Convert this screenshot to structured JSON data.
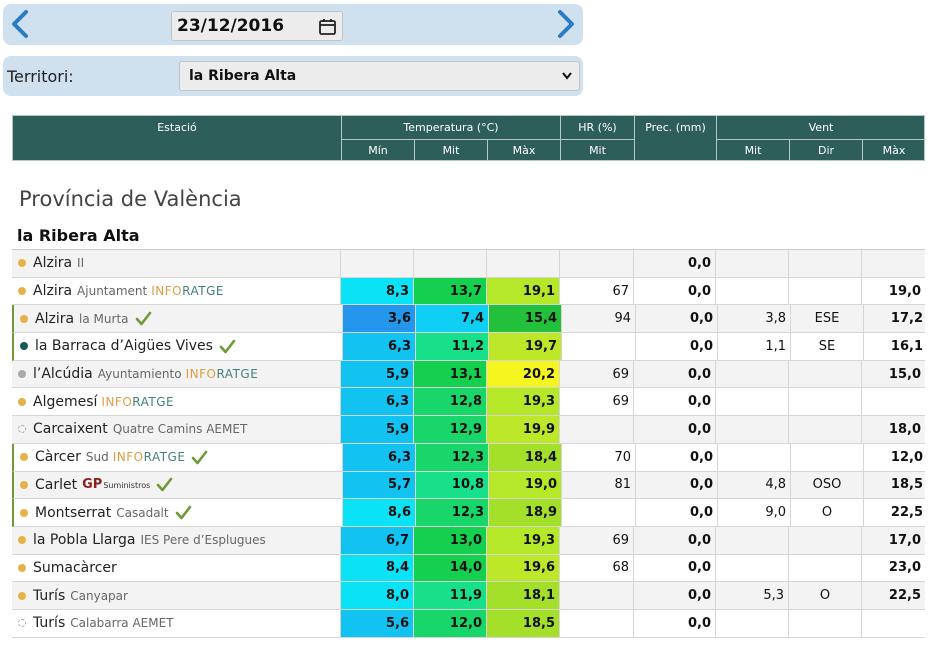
{
  "date_bar": {
    "date_value": "23/12/2016",
    "prev_icon": "chevron-left-icon",
    "next_icon": "chevron-right-icon",
    "calendar_icon": "calendar-icon",
    "accent_color": "#2a7bc4"
  },
  "territory": {
    "label": "Territori:",
    "selected": "la Ribera Alta"
  },
  "table_header": {
    "station": "Estació",
    "temperature": "Temperatura (°C)",
    "temp_min": "Mín",
    "temp_mit": "Mit",
    "temp_max": "Màx",
    "hr": "HR (%)",
    "hr_mit": "Mit",
    "prec": "Prec. (mm)",
    "vent": "Vent",
    "vent_mit": "Mit",
    "vent_dir": "Dir",
    "vent_max": "Màx",
    "bg_color": "#2e5e5a"
  },
  "province": "Província de València",
  "comarca": "la Ribera Alta",
  "stations": [
    {
      "name": "Alzira",
      "sub": "II",
      "dot": "#e3b34a",
      "marked": false,
      "info": false,
      "gp": false,
      "check": false,
      "min": "",
      "mit": "",
      "max": "",
      "hr": "",
      "prec": "0,0",
      "vmit": "",
      "vdir": "",
      "vmax": "",
      "min_color": "",
      "mit_color": "",
      "max_color": ""
    },
    {
      "name": "Alzira",
      "sub": "Ajuntament",
      "dot": "#e3b34a",
      "marked": false,
      "info": true,
      "gp": false,
      "check": false,
      "min": "8,3",
      "mit": "13,7",
      "max": "19,1",
      "hr": "67",
      "prec": "0,0",
      "vmit": "",
      "vdir": "",
      "vmax": "19,0",
      "min_color": "#0ce2f6",
      "mit_color": "#15cf4f",
      "max_color": "#b6e82a"
    },
    {
      "name": "Alzira",
      "sub": "la Murta",
      "dot": "#e3b34a",
      "marked": true,
      "info": false,
      "gp": false,
      "check": true,
      "min": "3,6",
      "mit": "7,4",
      "max": "15,4",
      "hr": "94",
      "prec": "0,0",
      "vmit": "3,8",
      "vdir": "ESE",
      "vmax": "17,2",
      "min_color": "#2496ec",
      "mit_color": "#10cff4",
      "max_color": "#22c03b"
    },
    {
      "name": "la Barraca d’Aigües Vives",
      "sub": "",
      "dot": "#115a5a",
      "marked": true,
      "info": false,
      "gp": false,
      "check": true,
      "min": "6,3",
      "mit": "11,2",
      "max": "19,7",
      "hr": "",
      "prec": "0,0",
      "vmit": "1,1",
      "vdir": "SE",
      "vmax": "16,1",
      "min_color": "#12c3f1",
      "mit_color": "#18e08a",
      "max_color": "#bde82a"
    },
    {
      "name": "l’Alcúdia",
      "sub": "Ayuntamiento",
      "dot": "#aaaaaa",
      "marked": false,
      "info": true,
      "gp": false,
      "check": false,
      "min": "5,9",
      "mit": "13,1",
      "max": "20,2",
      "hr": "69",
      "prec": "0,0",
      "vmit": "",
      "vdir": "",
      "vmax": "15,0",
      "min_color": "#12c3f1",
      "mit_color": "#15cf4f",
      "max_color": "#f5f520"
    },
    {
      "name": "Algemesí",
      "sub": "",
      "dot": "#e3b34a",
      "marked": false,
      "info": true,
      "gp": false,
      "check": false,
      "min": "6,3",
      "mit": "12,8",
      "max": "19,3",
      "hr": "69",
      "prec": "0,0",
      "vmit": "",
      "vdir": "",
      "vmax": "",
      "min_color": "#12c3f1",
      "mit_color": "#18d66a",
      "max_color": "#b6e82a"
    },
    {
      "name": "Carcaixent",
      "sub": "Quatre Camins AEMET",
      "dot": "dashed",
      "marked": false,
      "info": false,
      "gp": false,
      "check": false,
      "min": "5,9",
      "mit": "12,9",
      "max": "19,9",
      "hr": "",
      "prec": "0,0",
      "vmit": "",
      "vdir": "",
      "vmax": "18,0",
      "min_color": "#12c3f1",
      "mit_color": "#18d66a",
      "max_color": "#bde82a"
    },
    {
      "name": "Càrcer",
      "sub": "Sud",
      "dot": "#e3b34a",
      "marked": true,
      "info": true,
      "gp": false,
      "check": true,
      "min": "6,3",
      "mit": "12,3",
      "max": "18,4",
      "hr": "70",
      "prec": "0,0",
      "vmit": "",
      "vdir": "",
      "vmax": "12,0",
      "min_color": "#12c3f1",
      "mit_color": "#18d66a",
      "max_color": "#a4e02a"
    },
    {
      "name": "Carlet",
      "sub": "",
      "dot": "#e3b34a",
      "marked": true,
      "info": false,
      "gp": true,
      "check": true,
      "min": "5,7",
      "mit": "10,8",
      "max": "19,0",
      "hr": "81",
      "prec": "0,0",
      "vmit": "4,8",
      "vdir": "OSO",
      "vmax": "18,5",
      "min_color": "#12c3f1",
      "mit_color": "#18e08a",
      "max_color": "#b6e82a"
    },
    {
      "name": "Montserrat",
      "sub": "Casadalt",
      "dot": "#e3b34a",
      "marked": true,
      "info": false,
      "gp": false,
      "check": true,
      "min": "8,6",
      "mit": "12,3",
      "max": "18,9",
      "hr": "",
      "prec": "0,0",
      "vmit": "9,0",
      "vdir": "O",
      "vmax": "22,5",
      "min_color": "#0ce2f6",
      "mit_color": "#18d66a",
      "max_color": "#a4e02a"
    },
    {
      "name": "la Pobla Llarga",
      "sub": "IES Pere d’Esplugues",
      "dot": "#e3b34a",
      "marked": false,
      "info": false,
      "gp": false,
      "check": false,
      "min": "6,7",
      "mit": "13,0",
      "max": "19,3",
      "hr": "69",
      "prec": "0,0",
      "vmit": "",
      "vdir": "",
      "vmax": "17,0",
      "min_color": "#12c3f1",
      "mit_color": "#15cf4f",
      "max_color": "#b6e82a"
    },
    {
      "name": "Sumacàrcer",
      "sub": "",
      "dot": "#e3b34a",
      "marked": false,
      "info": false,
      "gp": false,
      "check": false,
      "min": "8,4",
      "mit": "14,0",
      "max": "19,6",
      "hr": "68",
      "prec": "0,0",
      "vmit": "",
      "vdir": "",
      "vmax": "23,0",
      "min_color": "#0ce2f6",
      "mit_color": "#15cf4f",
      "max_color": "#bde82a"
    },
    {
      "name": "Turís",
      "sub": "Canyapar",
      "dot": "#e3b34a",
      "marked": false,
      "info": false,
      "gp": false,
      "check": false,
      "min": "8,0",
      "mit": "11,9",
      "max": "18,1",
      "hr": "",
      "prec": "0,0",
      "vmit": "5,3",
      "vdir": "O",
      "vmax": "22,5",
      "min_color": "#0ce2f6",
      "mit_color": "#18e08a",
      "max_color": "#a4e02a"
    },
    {
      "name": "Turís",
      "sub": "Calabarra AEMET",
      "dot": "dashed",
      "marked": false,
      "info": false,
      "gp": false,
      "check": false,
      "min": "5,6",
      "mit": "12,0",
      "max": "18,5",
      "hr": "",
      "prec": "0,0",
      "vmit": "",
      "vdir": "",
      "vmax": "",
      "min_color": "#12c3f1",
      "mit_color": "#18d66a",
      "max_color": "#a4e02a"
    }
  ],
  "info_logo": {
    "part_a": "INFO",
    "part_b": "RATGE"
  },
  "gp_logo": {
    "text": "GP",
    "sub": "Suministros"
  }
}
